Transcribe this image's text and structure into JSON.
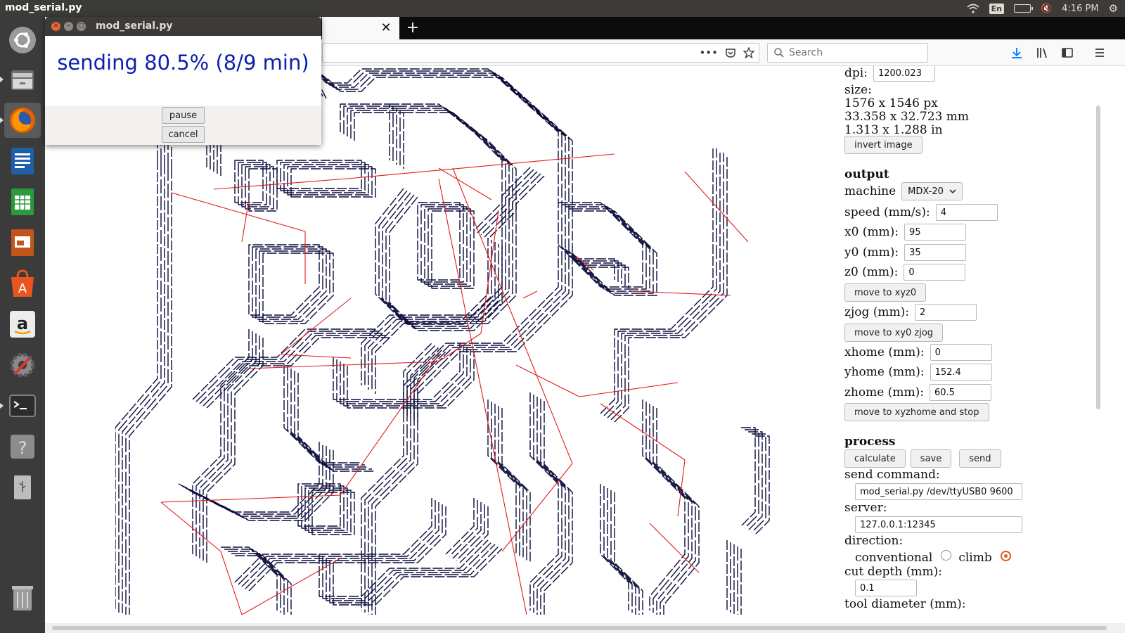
{
  "system": {
    "active_app": "mod_serial.py",
    "keyboard_layout": "En",
    "clock": "4:16 PM"
  },
  "launcher": {
    "items": [
      "ubuntu-dash",
      "files",
      "firefox",
      "libreoffice-writer",
      "libreoffice-calc",
      "libreoffice-impress",
      "ubuntu-software",
      "amazon",
      "system-settings",
      "terminal",
      "help",
      "usb-drive",
      "trash"
    ]
  },
  "browser": {
    "tab_close_glyph": "✕",
    "new_tab_glyph": "+",
    "search": {
      "placeholder": "Search"
    }
  },
  "panel": {
    "dpi_label": "dpi:",
    "dpi_value": "1200.023",
    "size_label": "size:",
    "size_px": "1576 x 1546 px",
    "size_mm": "33.358 x 32.723 mm",
    "size_in": "1.313 x 1.288 in",
    "invert_image": "invert image",
    "output_heading": "output",
    "machine_label": "machine",
    "machine_value": "MDX-20",
    "speed_label": "speed (mm/s):",
    "speed_value": "4",
    "x0_label": "x0 (mm):",
    "x0_value": "95",
    "y0_label": "y0 (mm):",
    "y0_value": "35",
    "z0_label": "z0 (mm):",
    "z0_value": "0",
    "move_xyz0": "move to xyz0",
    "zjog_label": "zjog (mm):",
    "zjog_value": "2",
    "move_xy0_zjog": "move to xy0 zjog",
    "xhome_label": "xhome (mm):",
    "xhome_value": "0",
    "yhome_label": "yhome (mm):",
    "yhome_value": "152.4",
    "zhome_label": "zhome (mm):",
    "zhome_value": "60.5",
    "move_home_stop": "move to xyzhome and stop",
    "process_heading": "process",
    "calculate": "calculate",
    "save": "save",
    "send": "send",
    "send_command_label": "send command:",
    "send_command_value": "mod_serial.py /dev/ttyUSB0 9600",
    "server_label": "server:",
    "server_value": "127.0.0.1:12345",
    "direction_label": "direction:",
    "conventional_label": "conventional",
    "climb_label": "climb",
    "direction_selected": "climb",
    "cut_depth_label": "cut depth (mm):",
    "cut_depth_value": "0.1",
    "tool_diameter_label": "tool diameter (mm):"
  },
  "dialog": {
    "title": "mod_serial.py",
    "message": "sending 80.5% (8/9 min)",
    "pause": "pause",
    "cancel": "cancel"
  },
  "colors": {
    "toolpath": "#0b0b3b",
    "rapid_moves": "#e31b1b",
    "progress_text": "#0c1fae",
    "launcher_bg": "#3b3b3b",
    "topbar_bg": "#3c3b37"
  }
}
